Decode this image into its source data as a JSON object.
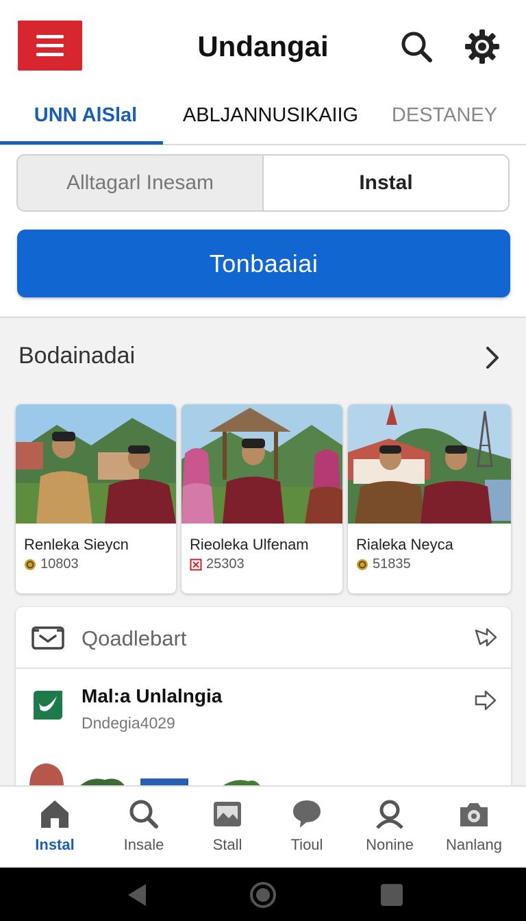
{
  "app": {
    "title": "Undangai",
    "brand_color": "#d7262e",
    "accent_color": "#1166d2"
  },
  "top_tabs": [
    {
      "label": "UNN AlSlal",
      "active": true
    },
    {
      "label": "ABLJANNUSIKAIIG",
      "active": false
    },
    {
      "label": "DESTANEY",
      "active": false
    }
  ],
  "segmented": {
    "left_label": "Alltagarl Inesam",
    "right_label": "Instal",
    "selected": "right"
  },
  "primary_button": {
    "label": "Tonbaaiai"
  },
  "section": {
    "title": "Bodainadai"
  },
  "cards": [
    {
      "name": "Renleka Sieycn",
      "value": "10803",
      "icon": "coin-icon"
    },
    {
      "name": "Rieoleka Ulfenam",
      "value": "25303",
      "icon": "flag-icon"
    },
    {
      "name": "Rialeka Neyca",
      "value": "51835",
      "icon": "coin-icon"
    }
  ],
  "list": {
    "header_label": "Qoadlebart",
    "items": [
      {
        "title": "Mal:a Unlalngia",
        "subtitle": "Dndegia4029"
      }
    ]
  },
  "bottom_nav": [
    {
      "label": "Instal",
      "icon": "home-icon",
      "active": true
    },
    {
      "label": "Insale",
      "icon": "search-icon",
      "active": false
    },
    {
      "label": "Stall",
      "icon": "gallery-icon",
      "active": false
    },
    {
      "label": "Tioul",
      "icon": "chat-icon",
      "active": false
    },
    {
      "label": "Nonine",
      "icon": "person-icon",
      "active": false
    },
    {
      "label": "Nanlang",
      "icon": "camera-icon",
      "active": false
    }
  ]
}
